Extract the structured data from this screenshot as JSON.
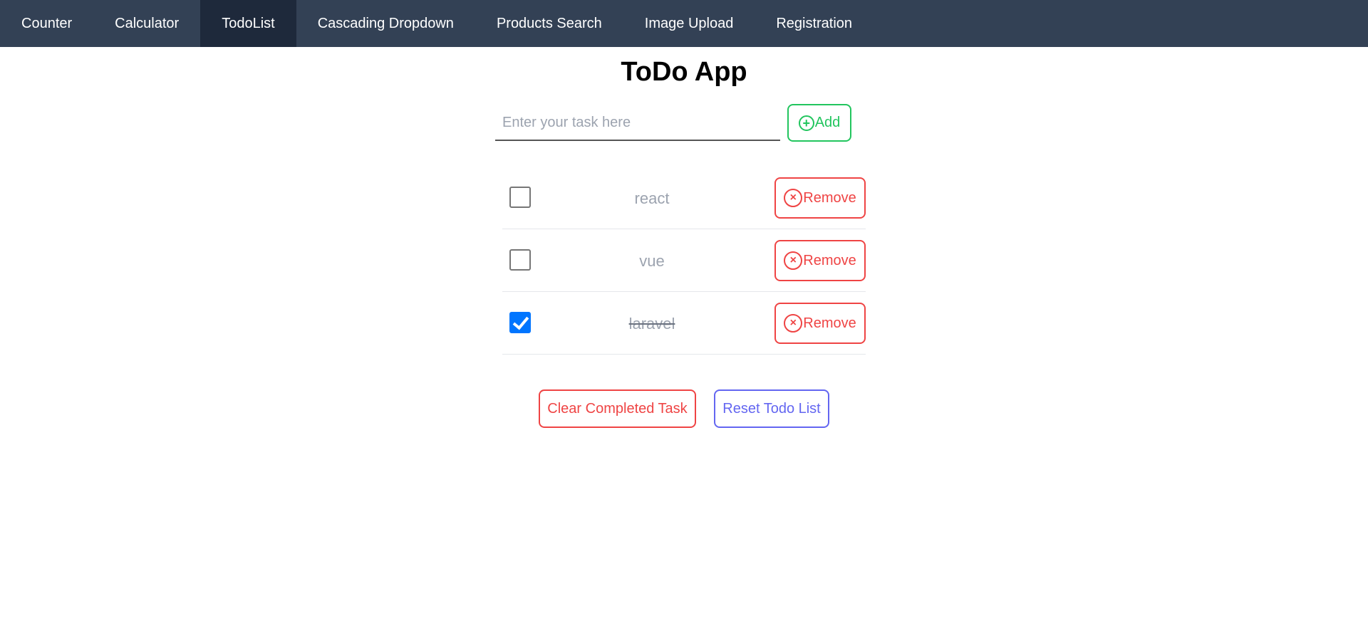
{
  "nav": {
    "items": [
      {
        "label": "Counter",
        "active": false
      },
      {
        "label": "Calculator",
        "active": false
      },
      {
        "label": "TodoList",
        "active": true
      },
      {
        "label": "Cascading Dropdown",
        "active": false
      },
      {
        "label": "Products Search",
        "active": false
      },
      {
        "label": "Image Upload",
        "active": false
      },
      {
        "label": "Registration",
        "active": false
      }
    ]
  },
  "page": {
    "title": "ToDo App"
  },
  "input": {
    "placeholder": "Enter your task here",
    "value": ""
  },
  "buttons": {
    "add_label": "Add",
    "add_icon": "⊕",
    "remove_label": "Remove",
    "remove_icon": "×",
    "clear_label": "Clear Completed Task",
    "reset_label": "Reset Todo List"
  },
  "todos": [
    {
      "text": "react",
      "completed": false
    },
    {
      "text": "vue",
      "completed": false
    },
    {
      "text": "laravel",
      "completed": true
    }
  ],
  "colors": {
    "navbar": "#334155",
    "nav_active": "#1e293b",
    "add": "#22c55e",
    "remove": "#ef4444",
    "reset": "#6366f1",
    "checkbox_checked": "#0075ff"
  }
}
